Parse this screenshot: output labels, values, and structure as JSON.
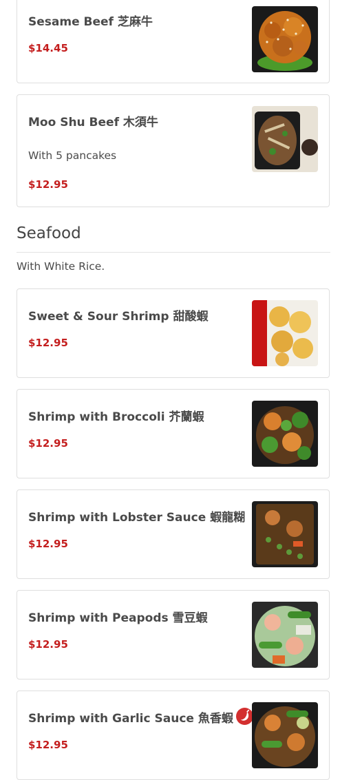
{
  "beef_items": [
    {
      "name": "Sesame Beef 芝麻牛",
      "description": "",
      "price": "$14.45"
    },
    {
      "name": "Moo Shu Beef 木須牛",
      "description": "With 5 pancakes",
      "price": "$12.95"
    }
  ],
  "section": {
    "title": "Seafood",
    "note": "With White Rice."
  },
  "seafood_items": [
    {
      "name": "Sweet & Sour Shrimp 甜酸蝦",
      "price": "$12.95"
    },
    {
      "name": "Shrimp with Broccoli 芥蘭蝦",
      "price": "$12.95"
    },
    {
      "name": "Shrimp with Lobster Sauce 蝦龍糊",
      "price": "$12.95"
    },
    {
      "name": "Shrimp with Peapods 雪豆蝦",
      "price": "$12.95"
    },
    {
      "name": "Shrimp with Garlic Sauce 魚香蝦",
      "price": "$12.95",
      "icon": "spicy-chili-icon"
    }
  ],
  "colors": {
    "price": "#c41e1e",
    "border": "#dedede",
    "text": "#4a4a4a",
    "spicy": "#d32f2f"
  }
}
